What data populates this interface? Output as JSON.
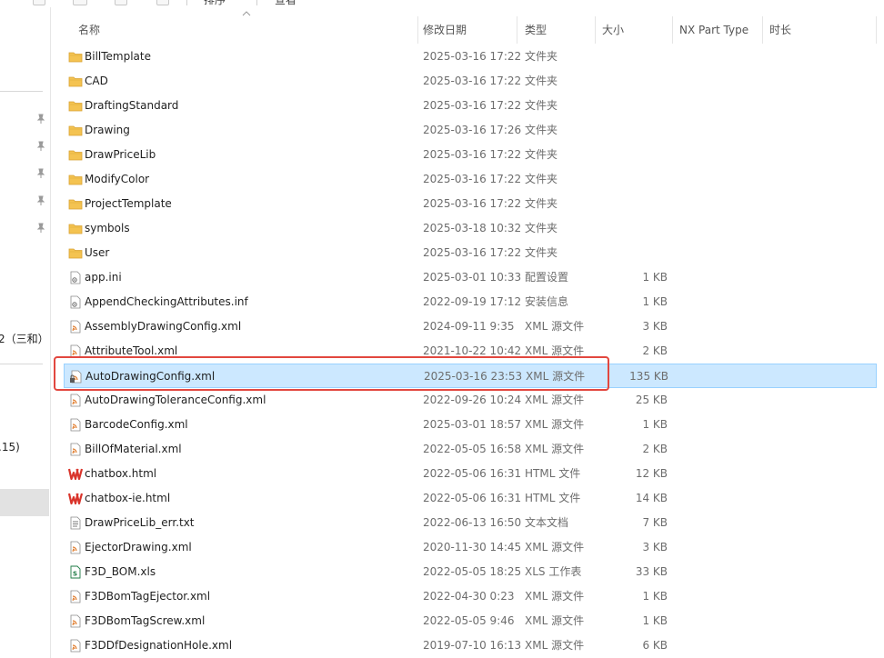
{
  "header": {
    "columns": [
      "名称",
      "修改日期",
      "类型",
      "大小",
      "NX Part Type",
      "时长"
    ]
  },
  "toolbar": {
    "labels": [
      "排序",
      "查看"
    ]
  },
  "nav": {
    "clipped_texts": [
      "2（三和）",
      ".15)"
    ]
  },
  "files": [
    {
      "name": "BillTemplate",
      "date": "2025-03-16 17:22",
      "type": "文件夹",
      "size": "",
      "icon": "folder-icon"
    },
    {
      "name": "CAD",
      "date": "2025-03-16 17:22",
      "type": "文件夹",
      "size": "",
      "icon": "folder-icon"
    },
    {
      "name": "DraftingStandard",
      "date": "2025-03-16 17:22",
      "type": "文件夹",
      "size": "",
      "icon": "folder-icon"
    },
    {
      "name": "Drawing",
      "date": "2025-03-16 17:26",
      "type": "文件夹",
      "size": "",
      "icon": "folder-icon"
    },
    {
      "name": "DrawPriceLib",
      "date": "2025-03-16 17:22",
      "type": "文件夹",
      "size": "",
      "icon": "folder-icon"
    },
    {
      "name": "ModifyColor",
      "date": "2025-03-16 17:22",
      "type": "文件夹",
      "size": "",
      "icon": "folder-icon"
    },
    {
      "name": "ProjectTemplate",
      "date": "2025-03-16 17:22",
      "type": "文件夹",
      "size": "",
      "icon": "folder-icon"
    },
    {
      "name": "symbols",
      "date": "2025-03-18 10:32",
      "type": "文件夹",
      "size": "",
      "icon": "folder-icon"
    },
    {
      "name": "User",
      "date": "2025-03-16 17:22",
      "type": "文件夹",
      "size": "",
      "icon": "folder-icon"
    },
    {
      "name": "app.ini",
      "date": "2025-03-01 10:33",
      "type": "配置设置",
      "size": "1 KB",
      "icon": "settings-file-icon"
    },
    {
      "name": "AppendCheckingAttributes.inf",
      "date": "2022-09-19 17:12",
      "type": "安装信息",
      "size": "1 KB",
      "icon": "settings-file-icon"
    },
    {
      "name": "AssemblyDrawingConfig.xml",
      "date": "2024-09-11 9:35",
      "type": "XML 源文件",
      "size": "3 KB",
      "icon": "xml-file-icon"
    },
    {
      "name": "AttributeTool.xml",
      "date": "2021-10-22 10:42",
      "type": "XML 源文件",
      "size": "2 KB",
      "icon": "xml-file-icon"
    },
    {
      "name": "AutoDrawingConfig.xml",
      "date": "2025-03-16 23:53",
      "type": "XML 源文件",
      "size": "135 KB",
      "icon": "xml-file-locked-icon",
      "selected": true
    },
    {
      "name": "AutoDrawingToleranceConfig.xml",
      "date": "2022-09-26 10:24",
      "type": "XML 源文件",
      "size": "25 KB",
      "icon": "xml-file-icon"
    },
    {
      "name": "BarcodeConfig.xml",
      "date": "2025-03-01 18:57",
      "type": "XML 源文件",
      "size": "1 KB",
      "icon": "xml-file-icon"
    },
    {
      "name": "BillOfMaterial.xml",
      "date": "2022-05-05 16:58",
      "type": "XML 源文件",
      "size": "2 KB",
      "icon": "xml-file-icon"
    },
    {
      "name": "chatbox.html",
      "date": "2022-05-06 16:31",
      "type": "HTML 文件",
      "size": "12 KB",
      "icon": "html-file-icon"
    },
    {
      "name": "chatbox-ie.html",
      "date": "2022-05-06 16:31",
      "type": "HTML 文件",
      "size": "14 KB",
      "icon": "html-file-icon"
    },
    {
      "name": "DrawPriceLib_err.txt",
      "date": "2022-06-13 16:50",
      "type": "文本文档",
      "size": "7 KB",
      "icon": "text-file-icon"
    },
    {
      "name": "EjectorDrawing.xml",
      "date": "2020-11-30 14:45",
      "type": "XML 源文件",
      "size": "3 KB",
      "icon": "xml-file-icon"
    },
    {
      "name": "F3D_BOM.xls",
      "date": "2022-05-05 18:25",
      "type": "XLS 工作表",
      "size": "33 KB",
      "icon": "spreadsheet-file-icon"
    },
    {
      "name": "F3DBomTagEjector.xml",
      "date": "2022-04-30 0:23",
      "type": "XML 源文件",
      "size": "1 KB",
      "icon": "xml-file-icon"
    },
    {
      "name": "F3DBomTagScrew.xml",
      "date": "2022-05-05 9:46",
      "type": "XML 源文件",
      "size": "1 KB",
      "icon": "xml-file-icon"
    },
    {
      "name": "F3DDfDesignationHole.xml",
      "date": "2019-07-10 16:13",
      "type": "XML 源文件",
      "size": "6 KB",
      "icon": "xml-file-icon"
    }
  ],
  "colors": {
    "selection_bg": "#cce8ff",
    "selection_border": "#99d1ff",
    "highlight_box": "#e2473f",
    "folder": "#f4c351",
    "xml_accent": "#e07b2a",
    "html_accent": "#d9342b",
    "xls_accent": "#1e7b45"
  }
}
